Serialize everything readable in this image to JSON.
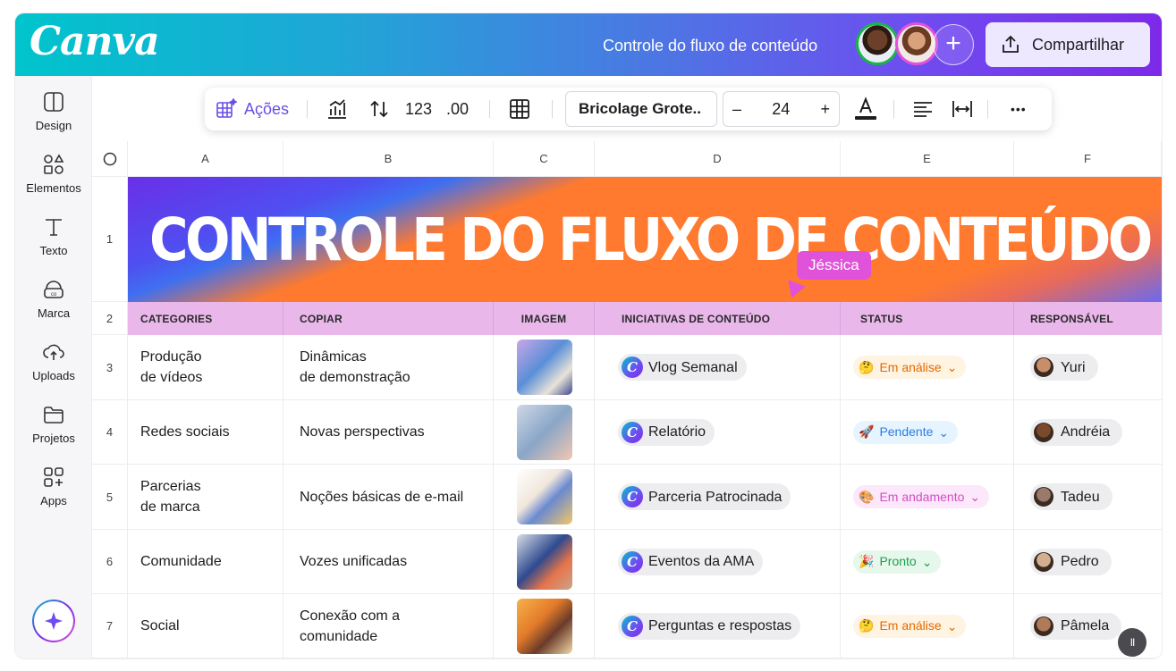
{
  "topbar": {
    "logo": "Canva",
    "doc_title": "Controle do fluxo de conteúdo",
    "add_collaborator": "+",
    "share_label": "Compartilhar"
  },
  "sidebar": {
    "items": [
      {
        "label": "Design",
        "icon": "layout-icon"
      },
      {
        "label": "Elementos",
        "icon": "shapes-icon"
      },
      {
        "label": "Texto",
        "icon": "text-icon"
      },
      {
        "label": "Marca",
        "icon": "brand-icon"
      },
      {
        "label": "Uploads",
        "icon": "cloud-upload-icon"
      },
      {
        "label": "Projetos",
        "icon": "folder-icon"
      },
      {
        "label": "Apps",
        "icon": "apps-icon"
      }
    ]
  },
  "toolbar": {
    "actions_label": "Ações",
    "number_format": "123",
    "decimals": ".00",
    "font_name": "Bricolage Grote..",
    "font_size": "24",
    "minus": "–",
    "plus": "+",
    "more": "•••"
  },
  "sheet": {
    "columns": [
      "A",
      "B",
      "C",
      "D",
      "E",
      "F"
    ],
    "rows": [
      "1",
      "2",
      "3",
      "4",
      "5",
      "6",
      "7"
    ],
    "banner_title": "CONTROLE DO FLUXO DE CONTEÚDO",
    "cursor_user": "Jéssica",
    "headers": [
      "CATEGORIES",
      "COPIAR",
      "IMAGEM",
      "INICIATIVAS DE CONTEÚDO",
      "STATUS",
      "RESPONSÁVEL"
    ],
    "data": [
      {
        "category": "Produção\nde vídeos",
        "copy": "Dinâmicas\nde demonstração",
        "initiative": "Vlog Semanal",
        "status": "Em análise",
        "status_emoji": "🤔",
        "owner": "Yuri"
      },
      {
        "category": "Redes sociais",
        "copy": "Novas perspectivas",
        "initiative": "Relatório",
        "status": "Pendente",
        "status_emoji": "🚀",
        "owner": "Andréia"
      },
      {
        "category": "Parcerias\nde marca",
        "copy": "Noções básicas de e-mail",
        "initiative": "Parceria Patrocinada",
        "status": "Em andamento",
        "status_emoji": "🎨",
        "owner": "Tadeu"
      },
      {
        "category": "Comunidade",
        "copy": "Vozes unificadas",
        "initiative": "Eventos da AMA",
        "status": "Pronto",
        "status_emoji": "🎉",
        "owner": "Pedro"
      },
      {
        "category": "Social",
        "copy": "Conexão com a\ncomunidade",
        "initiative": "Perguntas e respostas",
        "status": "Em análise",
        "status_emoji": "🤔",
        "owner": "Pâmela"
      }
    ],
    "status_colors": {
      "Em análise": {
        "bg": "#fff3e2",
        "fg": "#e36a00"
      },
      "Pendente": {
        "bg": "#e6f4ff",
        "fg": "#2a7de1"
      },
      "Em andamento": {
        "bg": "#fde8fb",
        "fg": "#d24cc6"
      },
      "Pronto": {
        "bg": "#e6f8ec",
        "fg": "#1e9e4a"
      }
    }
  },
  "playback": {
    "pause": "II"
  }
}
